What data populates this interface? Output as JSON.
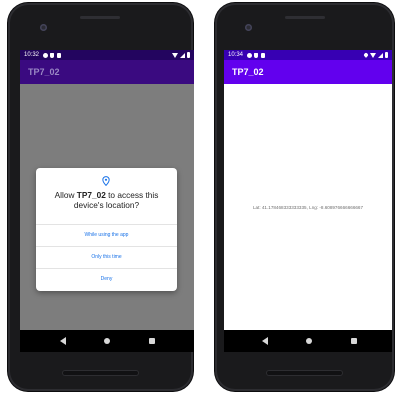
{
  "left_phone": {
    "status_time": "10:32",
    "app_title": "TP7_02",
    "dialog": {
      "title_prefix": "Allow ",
      "title_app": "TP7_02",
      "title_suffix": " to access this device's location?",
      "buttons": [
        "While using the app",
        "Only this time",
        "Deny"
      ]
    }
  },
  "right_phone": {
    "status_time": "10:34",
    "app_title": "TP7_02",
    "coordinates_text": "Lat: 41.178468333333335, Lng: -8.608976666666667"
  },
  "icons": {
    "status_left": [
      "gear-icon",
      "shield-icon",
      "sim-card-icon"
    ],
    "status_right": [
      "location-icon",
      "wifi-icon",
      "signal-icon",
      "battery-icon"
    ],
    "dialog": "location-pin-icon",
    "nav": [
      "back-icon",
      "home-icon",
      "recents-icon"
    ]
  },
  "colors": {
    "primary": "#6200ee",
    "primary_dark": "#3700b3",
    "dialog_button": "#1a73e8",
    "scrim_background": "#7f7f7f"
  }
}
